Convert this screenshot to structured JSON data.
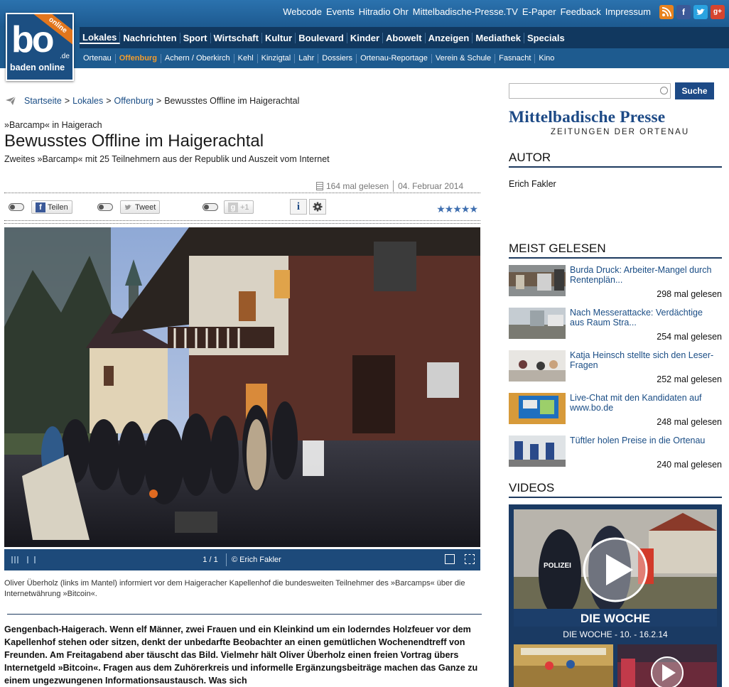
{
  "header": {
    "logo_text": "bo",
    "logo_tld": ".de",
    "logo_ribbon": "online",
    "logo_subtitle": "baden online",
    "service_links": [
      "Webcode",
      "Events",
      "Hitradio Ohr",
      "Mittelbadische-Presse.TV",
      "E-Paper",
      "Feedback",
      "Impressum"
    ],
    "social_icons": [
      "rss-icon",
      "facebook-icon",
      "twitter-icon",
      "google-plus-icon"
    ],
    "main_nav": [
      "Lokales",
      "Nachrichten",
      "Sport",
      "Wirtschaft",
      "Kultur",
      "Boulevard",
      "Kinder",
      "Abowelt",
      "Anzeigen",
      "Mediathek",
      "Specials"
    ],
    "main_nav_active": "Lokales",
    "sub_nav": [
      "Ortenau",
      "Offenburg",
      "Achern / Oberkirch",
      "Kehl",
      "Kinzigtal",
      "Lahr",
      "Dossiers",
      "Ortenau-Reportage",
      "Verein & Schule",
      "Fasnacht",
      "Kino"
    ],
    "sub_nav_active": "Offenburg",
    "colors": {
      "header_bg": "#1e5b8f",
      "nav_bg": "#11385f",
      "active_subnav": "#f29c2d"
    }
  },
  "breadcrumb": {
    "items": [
      "Startseite",
      "Lokales",
      "Offenburg"
    ],
    "separator": ">",
    "current": "Bewusstes Offline im Haigerachtal"
  },
  "article": {
    "kicker": "»Barcamp« in Haigerach",
    "headline": "Bewusstes Offline im Haigerachtal",
    "subline": "Zweites »Barcamp« mit 25 Teilnehmern aus der Republik und Auszeit vom Internet",
    "reads": "164 mal gelesen",
    "date": "04. Februar 2014",
    "share": {
      "facebook_label": "Teilen",
      "twitter_label": "Tweet",
      "google_label": "+1",
      "info_label": "i",
      "settings_icon": "gear-icon",
      "rating_stars": 5
    },
    "gallery": {
      "counter": "1 / 1",
      "credit": "© Erich Fakler"
    },
    "caption": "Oliver Überholz (links im Mantel) informiert vor dem Haigeracher Kapellenhof die bundesweiten Teilnehmer des »Barcamps« über die Internetwährung »Bitcoin«.",
    "body": "Gengenbach-Haigerach. Wenn elf Männer, zwei Frauen und ein Kleinkind um ein loderndes Holzfeuer vor dem Kapellenhof stehen oder sitzen, denkt der unbedarfte Beobachter an einen gemütlichen Wochenendtreff von Freunden. Am Freitagabend aber täuscht das Bild. Vielmehr hält Oliver Überholz einen freien Vortrag übers Internetgeld »Bitcoin«. Fragen aus dem Zuhörerkreis und informelle Ergänzungsbeiträge machen das Ganze zu einem ungezwungenen Informationsaustausch. Was sich"
  },
  "sidebar": {
    "search_placeholder": "",
    "search_button": "Suche",
    "brand_title": "Mittelbadische Presse",
    "brand_subtitle": "ZEITUNGEN DER ORTENAU",
    "author_heading": "AUTOR",
    "author_name": "Erich Fakler",
    "most_read_heading": "MEIST GELESEN",
    "most_read": [
      {
        "title": "Burda Druck: Arbeiter-Mangel durch Rentenplän...",
        "reads": "298 mal gelesen"
      },
      {
        "title": "Nach Messerattacke: Verdächtige aus Raum Stra...",
        "reads": "254 mal gelesen"
      },
      {
        "title": "Katja Heinsch stellte sich den Leser-Fragen",
        "reads": "252 mal gelesen"
      },
      {
        "title": "Live-Chat mit den Kandidaten auf www.bo.de",
        "reads": "248 mal gelesen"
      },
      {
        "title": "Tüftler holen Preise in die Ortenau",
        "reads": "240 mal gelesen"
      }
    ],
    "videos_heading": "VIDEOS",
    "video_overlay": "DIE WOCHE",
    "video_caption": "DIE WOCHE - 10. - 16.2.14",
    "video_badge": "POLIZEI"
  }
}
